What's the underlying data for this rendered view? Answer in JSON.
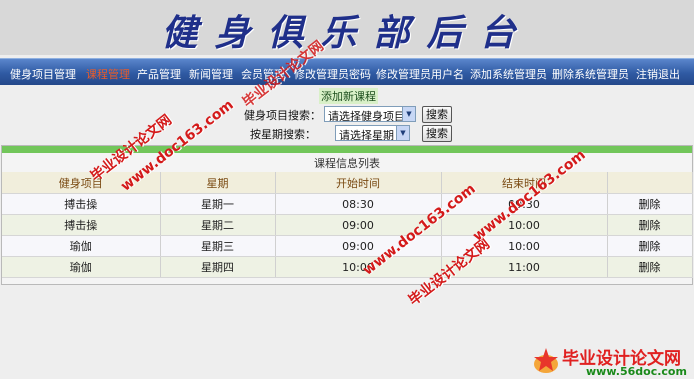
{
  "banner": {
    "title": "健身俱乐部后台"
  },
  "nav": {
    "items": [
      {
        "label": "健身项目管理"
      },
      {
        "label": "课程管理"
      },
      {
        "label": "产品管理"
      },
      {
        "label": "新闻管理"
      },
      {
        "label": "会员管理"
      },
      {
        "label": "修改管理员密码"
      },
      {
        "label": "修改管理员用户名"
      },
      {
        "label": "添加系统管理员"
      },
      {
        "label": "删除系统管理员"
      },
      {
        "label": "注销退出"
      }
    ]
  },
  "actions": {
    "add_course": "添加新课程"
  },
  "search": {
    "project_label": "健身项目搜索：",
    "project_select": "请选择健身项目",
    "project_button": "搜索",
    "weekday_label": "按星期搜索：",
    "weekday_select": "请选择星期",
    "weekday_button": "搜索"
  },
  "course_list": {
    "caption": "课程信息列表",
    "headers": [
      "健身项目",
      "星期",
      "开始时间",
      "结束时间",
      ""
    ],
    "rows": [
      {
        "project": "搏击操",
        "weekday": "星期一",
        "start": "08:30",
        "end": "09:30",
        "action": "删除"
      },
      {
        "project": "搏击操",
        "weekday": "星期二",
        "start": "09:00",
        "end": "10:00",
        "action": "删除"
      },
      {
        "project": "瑜伽",
        "weekday": "星期三",
        "start": "09:00",
        "end": "10:00",
        "action": "删除"
      },
      {
        "project": "瑜伽",
        "weekday": "星期四",
        "start": "10:00",
        "end": "11:00",
        "action": "删除"
      }
    ]
  },
  "watermarks": {
    "text1": "毕业设计论文网",
    "url1": "www.doc163.com",
    "text2": "毕业设计论文网",
    "url2": "www.doc163.com",
    "text3": "毕业设计论文网",
    "url3": "www.doc163.com"
  },
  "footer": {
    "logo_text": "毕业设计论文网",
    "logo_url": "www.56doc.com"
  }
}
